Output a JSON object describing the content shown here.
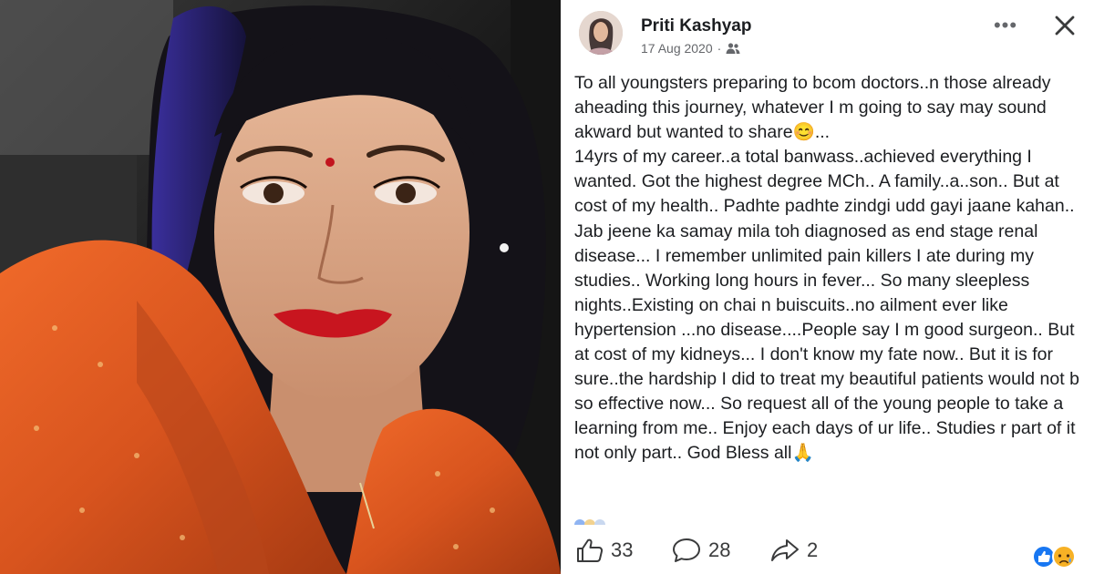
{
  "post": {
    "author": "Priti Kashyap",
    "date": "17 Aug 2020",
    "separator": "·",
    "more_label": "•••",
    "body": "To all youngsters preparing to bcom doctors..n those already aheading this journey, whatever I m going to say may sound akward but wanted to share😊...\n14yrs of my career..a total banwass..achieved everything I wanted. Got the highest degree MCh.. A family..a..son.. But at cost of my health.. Padhte padhte zindgi udd gayi jaane kahan.. Jab jeene ka samay mila toh diagnosed as end stage renal disease... I remember unlimited pain killers I ate during my studies.. Working long hours in fever... So many sleepless nights..Existing on chai n buiscuits..no ailment ever like hypertension ...no disease....People say I m good surgeon.. But at cost of my kidneys... I don't know my fate now.. But it is for sure..the hardship I did to treat my beautiful patients would not b so effective now... So request all of the young people to take a learning from me.. Enjoy each days of ur life.. Studies r part of it not only part.. God Bless all🙏",
    "likes": "33",
    "comments": "28",
    "shares": "2"
  },
  "icons": {
    "audience": "friends-icon",
    "more": "more-icon",
    "close": "close-icon",
    "like": "thumbs-up-icon",
    "comment": "comment-bubble-icon",
    "share": "share-arrow-icon",
    "reactions": "like-and-sad-reaction-icons"
  },
  "colors": {
    "text": "#1c1e21",
    "meta": "#65676b",
    "like_blue": "#1877f2",
    "sad_yellow": "#f7b125",
    "saree_orange": "#d8541e",
    "hair_blue": "#3a2f9c"
  }
}
